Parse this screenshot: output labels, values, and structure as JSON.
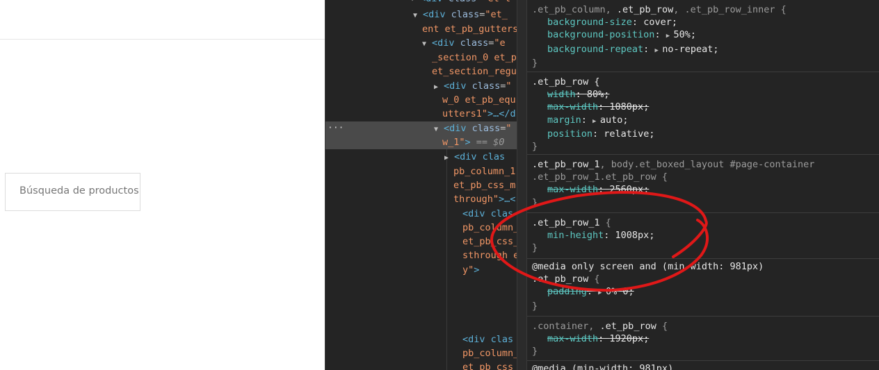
{
  "page": {
    "search_placeholder": "Búsqueda de productos"
  },
  "elements": {
    "lines": [
      {
        "text_tag": "<div class=\"et-l",
        "kind": "partial-top"
      },
      {
        "text_tag": "<div class=\"et_",
        "kind": "expanded"
      },
      {
        "text": "ent et_pb_gutters"
      },
      {
        "text_tag": "<div class=\"e",
        "kind": "expanded"
      },
      {
        "text": "_section_0 et_p"
      },
      {
        "text": "et_section_regu"
      },
      {
        "text_tag": "<div class=\"",
        "kind": "collapsed"
      },
      {
        "text": "w_0 et_pb_equ"
      },
      {
        "text": "utters1\">…</d"
      },
      {
        "text_tag": "<div class=\"",
        "kind": "expanded-selected"
      },
      {
        "text": "w_1\">",
        "suffix": "== $0"
      },
      {
        "text_tag": "<div clas",
        "kind": "collapsed"
      },
      {
        "text": "pb_column_1"
      },
      {
        "text": "et_pb_css_m"
      },
      {
        "text": "through\">…<"
      },
      {
        "text_tag": "<div clas"
      },
      {
        "text": "pb_column_"
      },
      {
        "text": "et_pb_css_"
      },
      {
        "text": "sthrough e"
      },
      {
        "text": "y\">"
      },
      {
        "text_tag": "<div clas"
      },
      {
        "text": "pb_column_"
      },
      {
        "text": "et_pb_css_"
      }
    ],
    "ellipsis": "···"
  },
  "styles": {
    "rules": [
      {
        "selector_parts": [
          {
            "t": ".et_pb_column, ",
            "dim": true
          },
          {
            "t": ".et_pb_row",
            "dim": false
          },
          {
            "t": ", ",
            "dim": true
          },
          {
            "t": ".et_pb_row_inner",
            "dim": true
          },
          {
            "t": " {",
            "dim": true
          }
        ],
        "props": [
          {
            "name": "background-size",
            "value": "cover;"
          },
          {
            "name": "background-position",
            "value": "50%;",
            "arrow": true
          },
          {
            "name": "background-repeat",
            "value": "no-repeat;",
            "arrow": true
          }
        ]
      },
      {
        "selector_parts": [
          {
            "t": ".et_pb_row",
            "dim": false
          },
          {
            "t": " {",
            "dim": false
          }
        ],
        "props": [
          {
            "name": "width",
            "value": "80%;",
            "strike": true
          },
          {
            "name": "max-width",
            "value": "1080px;",
            "strike": true
          },
          {
            "name": "margin",
            "value": "auto;",
            "arrow": true
          },
          {
            "name": "position",
            "value": "relative;"
          }
        ]
      },
      {
        "selector_parts": [
          {
            "t": ".et_pb_row_1",
            "dim": false
          },
          {
            "t": ", body.et_boxed_layout #page-container",
            "dim": true
          }
        ],
        "selector_line2": [
          {
            "t": ".et_pb_row_1.et_pb_row {",
            "dim": true
          }
        ],
        "props": [
          {
            "name": "max-width",
            "value": "2560px;",
            "strike": true
          }
        ]
      },
      {
        "selector_parts": [
          {
            "t": ".et_pb_row_1",
            "dim": false
          },
          {
            "t": " {",
            "dim": true
          }
        ],
        "props": [
          {
            "name": "min-height",
            "value": "1008px;"
          }
        ]
      },
      {
        "media": "@media only screen and (min-width: 981px)",
        "selector_parts": [
          {
            "t": ".et_pb_row",
            "dim": false
          },
          {
            "t": " {",
            "dim": true
          }
        ],
        "props": [
          {
            "name": "padding",
            "value": "0% 0;",
            "strike": true,
            "arrow": true
          }
        ]
      },
      {
        "selector_parts": [
          {
            "t": ".container, ",
            "dim": true
          },
          {
            "t": ".et_pb_row",
            "dim": false
          },
          {
            "t": " {",
            "dim": true
          }
        ],
        "props": [
          {
            "name": "max-width",
            "value": "1920px;",
            "strike": true
          }
        ]
      },
      {
        "media": "@media (min-width: 981px)",
        "selector_parts": [],
        "props": []
      }
    ],
    "close_brace": "}"
  },
  "colors": {
    "annotation": "#e01818",
    "panel_bg": "#242424",
    "prop_name": "#5ec9c3",
    "tag": "#5db0d7",
    "attr_value": "#f29766"
  }
}
